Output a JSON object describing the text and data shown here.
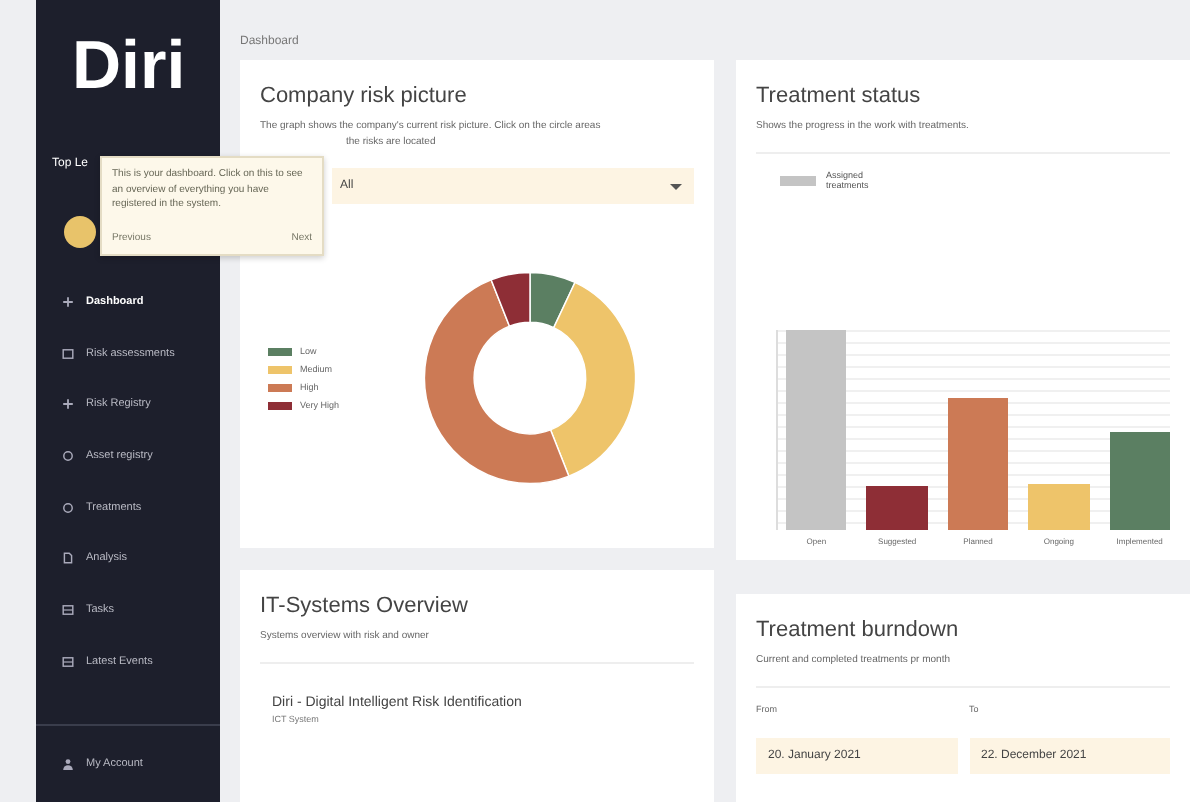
{
  "sidebar": {
    "logo": "Diri",
    "org": "Top Le",
    "items": [
      {
        "label": "Dashboard",
        "selected": true
      },
      {
        "label": "Risk assessments",
        "selected": false
      },
      {
        "label": "Risk Registry",
        "selected": false
      },
      {
        "label": "Asset registry",
        "selected": false
      },
      {
        "label": "Treatments",
        "selected": false
      },
      {
        "label": "Analysis",
        "selected": false
      },
      {
        "label": "Tasks",
        "selected": false
      },
      {
        "label": "Latest Events",
        "selected": false
      }
    ],
    "account": "My Account"
  },
  "breadcrumb": "Dashboard",
  "tooltip": {
    "text": "This is your dashboard. Click on this to see an overview of everything you have registered in the system.",
    "previous": "Previous",
    "next": "Next"
  },
  "risk_card": {
    "title": "Company risk picture",
    "description": "The graph shows the company's current risk picture. Click on the circle areas",
    "description_tail": "the risks are located",
    "filter": "All",
    "legend": [
      {
        "label": "Low",
        "color": "#5b7f62"
      },
      {
        "label": "Medium",
        "color": "#eec46a"
      },
      {
        "label": "High",
        "color": "#cc7a55"
      },
      {
        "label": "Very High",
        "color": "#8e2e36"
      }
    ]
  },
  "status_card": {
    "title": "Treatment status",
    "description": "Shows the progress in the work with treatments.",
    "legend": "Assigned treatments",
    "categories": [
      "Open",
      "Suggested",
      "Planned",
      "Ongoing",
      "Implemented"
    ]
  },
  "systems_card": {
    "title": "IT-Systems Overview",
    "description": "Systems overview with risk and owner",
    "systems": [
      {
        "name": "Diri - Digital Intelligent Risk Identification",
        "type": "ICT System"
      }
    ]
  },
  "burndown_card": {
    "title": "Treatment burndown",
    "description": "Current and completed treatments pr month",
    "from_label": "From",
    "to_label": "To",
    "from": "20. January 2021",
    "to": "22. December 2021"
  }
}
